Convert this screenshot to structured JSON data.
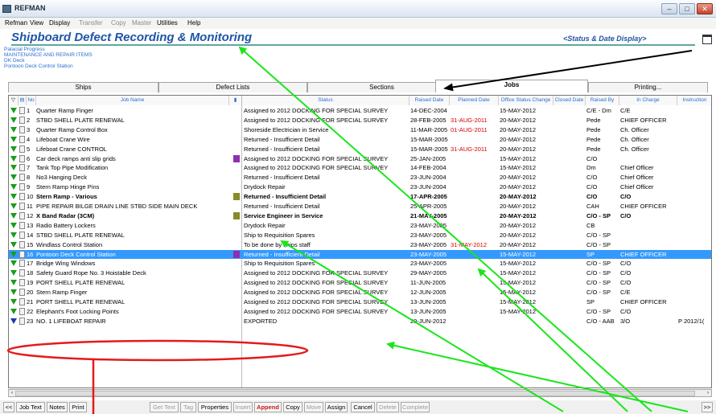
{
  "window": {
    "title": "REFMAN",
    "minimize": "–",
    "maximize": "□",
    "close": "✕"
  },
  "menu": [
    {
      "label": "Refman",
      "enabled": true
    },
    {
      "label": "View",
      "enabled": true
    },
    {
      "label": "Display",
      "enabled": true
    },
    {
      "label": "Transfer",
      "enabled": false
    },
    {
      "label": "Copy",
      "enabled": false
    },
    {
      "label": "Master",
      "enabled": false
    },
    {
      "label": "Utilities",
      "enabled": true
    },
    {
      "label": "Help",
      "enabled": true
    }
  ],
  "header": {
    "title": "Shipboard Defect Recording & Monitoring",
    "status_link": "<Status & Date Display>"
  },
  "breadcrumbs": [
    "Palacial Progress",
    "MAINTENANCE AND REPAIR ITEMS",
    "DK Deck",
    "Pontoon Deck Control Station"
  ],
  "tabs": [
    {
      "label": "Ships",
      "active": false
    },
    {
      "label": "Defect Lists",
      "active": false
    },
    {
      "label": "Sections",
      "active": false
    },
    {
      "label": "Jobs",
      "active": true
    },
    {
      "label": "Printing...",
      "active": false
    }
  ],
  "columns": {
    "no": "No",
    "job": "Job Name",
    "status": "Status",
    "raised": "Raised Date",
    "planned": "Planned Date",
    "office": "Office Status Change",
    "closed": "Closed Date",
    "by": "Raised By",
    "charge": "In Charge",
    "instr": "Instruction"
  },
  "rows": [
    {
      "no": "1",
      "job": "Quarter Ramp Finger",
      "status": "Assigned to 2012 DOCKING FOR SPECIAL SURVEY",
      "raised": "14-DEC-2004",
      "planned": "",
      "office": "15-MAY-2012",
      "closed": "",
      "by": "C/E - Dm",
      "charge": "C/E",
      "instr": "",
      "bold": false,
      "flag": "",
      "icon": "green"
    },
    {
      "no": "2",
      "job": "STBD SHELL PLATE RENEWAL",
      "status": "Assigned to 2012 DOCKING FOR SPECIAL SURVEY",
      "raised": "28-FEB-2005",
      "planned": "31-AUG-2011",
      "office": "20-MAY-2012",
      "closed": "",
      "by": "Pede",
      "charge": "CHIEF OFFICER",
      "instr": "",
      "bold": false,
      "flag": "",
      "icon": "green"
    },
    {
      "no": "3",
      "job": "Quarter Ramp Control Box",
      "status": "Shoreside Electrician in Service",
      "raised": "11-MAR-2005",
      "planned": "01-AUG-2011",
      "office": "20-MAY-2012",
      "closed": "",
      "by": "Pede",
      "charge": "Ch. Officer",
      "instr": "",
      "bold": false,
      "flag": "",
      "icon": "green"
    },
    {
      "no": "4",
      "job": "Lifeboat Crane Wire",
      "status": "Returned - Insufficient Detail",
      "raised": "15-MAR-2005",
      "planned": "",
      "office": "20-MAY-2012",
      "closed": "",
      "by": "Pede",
      "charge": "Ch. Officer",
      "instr": "",
      "bold": false,
      "flag": "",
      "icon": "green"
    },
    {
      "no": "5",
      "job": "Lifeboat Crane CONTROL",
      "status": "Returned - Insufficient Detail",
      "raised": "15-MAR-2005",
      "planned": "31-AUG-2011",
      "office": "20-MAY-2012",
      "closed": "",
      "by": "Pede",
      "charge": "Ch. Officer",
      "instr": "",
      "bold": false,
      "flag": "",
      "icon": "green"
    },
    {
      "no": "6",
      "job": "Car deck ramps anti slip grids",
      "status": "Assigned to 2012 DOCKING FOR SPECIAL SURVEY",
      "raised": "25-JAN-2005",
      "planned": "",
      "office": "15-MAY-2012",
      "closed": "",
      "by": "C/O",
      "charge": "",
      "instr": "",
      "bold": false,
      "flag": "purple",
      "icon": "green"
    },
    {
      "no": "7",
      "job": "Tank Top Pipe Modification",
      "status": "Assigned to 2012 DOCKING FOR SPECIAL SURVEY",
      "raised": "14-FEB-2004",
      "planned": "",
      "office": "15-MAY-2012",
      "closed": "",
      "by": "Dm",
      "charge": "Chief Officer",
      "instr": "",
      "bold": false,
      "flag": "",
      "icon": "green"
    },
    {
      "no": "8",
      "job": "No3 Hanging Deck",
      "status": "Returned - Insufficient Detail",
      "raised": "23-JUN-2004",
      "planned": "",
      "office": "20-MAY-2012",
      "closed": "",
      "by": "C/O",
      "charge": "Chief Officer",
      "instr": "",
      "bold": false,
      "flag": "",
      "icon": "green"
    },
    {
      "no": "9",
      "job": "Stern Ramp Hinge Pins",
      "status": "Drydock Repair",
      "raised": "23-JUN-2004",
      "planned": "",
      "office": "20-MAY-2012",
      "closed": "",
      "by": "C/O",
      "charge": "Chief Officer",
      "instr": "",
      "bold": false,
      "flag": "",
      "icon": "green"
    },
    {
      "no": "10",
      "job": "Stern Ramp - Various",
      "status": "Returned - Insufficient Detail",
      "raised": "17-APR-2005",
      "planned": "",
      "office": "20-MAY-2012",
      "closed": "",
      "by": "C/O",
      "charge": "C/O",
      "instr": "",
      "bold": true,
      "flag": "olive",
      "icon": "green"
    },
    {
      "no": "11",
      "job": "PIPE REPAIR BILGE DRAIN LINE STBD SIDE MAIN DECK",
      "status": "Returned - Insufficient Detail",
      "raised": "25-APR-2005",
      "planned": "",
      "office": "20-MAY-2012",
      "closed": "",
      "by": "CAH",
      "charge": "CHIEF OFFICER",
      "instr": "",
      "bold": false,
      "flag": "",
      "icon": "green"
    },
    {
      "no": "12",
      "job": "X Band Radar (3CM)",
      "status": "Service Engineer in Service",
      "raised": "21-MAY-2005",
      "planned": "",
      "office": "20-MAY-2012",
      "closed": "",
      "by": "C/O - SP",
      "charge": "C/O",
      "instr": "",
      "bold": true,
      "flag": "olive",
      "icon": "green"
    },
    {
      "no": "13",
      "job": "Radio Battery Lockers",
      "status": "Drydock Repair",
      "raised": "23-MAY-2005",
      "planned": "",
      "office": "20-MAY-2012",
      "closed": "",
      "by": "CB",
      "charge": "",
      "instr": "",
      "bold": false,
      "flag": "",
      "icon": "green"
    },
    {
      "no": "14",
      "job": "STBD SHELL PLATE RENEWAL",
      "status": "Ship to Requisition Spares",
      "raised": "23-MAY-2005",
      "planned": "",
      "office": "20-MAY-2012",
      "closed": "",
      "by": "C/O - SP",
      "charge": "",
      "instr": "",
      "bold": false,
      "flag": "",
      "icon": "green"
    },
    {
      "no": "15",
      "job": "Windlass Control Station",
      "status": "To be done by ships staff",
      "raised": "23-MAY-2005",
      "planned": "31-MAY-2012",
      "office": "20-MAY-2012",
      "closed": "",
      "by": "C/O - SP",
      "charge": "",
      "instr": "",
      "bold": false,
      "flag": "",
      "icon": "green"
    },
    {
      "no": "16",
      "job": "Pontoon Deck Control Station",
      "status": "Returned - Insufficient Detail",
      "raised": "23-MAY-2005",
      "planned": "",
      "office": "15-MAY-2012",
      "closed": "",
      "by": "SP",
      "charge": "CHIEF OFFICER",
      "instr": "",
      "bold": false,
      "flag": "purple",
      "icon": "green",
      "selected": true
    },
    {
      "no": "17",
      "job": "Bridge Wing Windows",
      "status": "Ship to Requisition Spares",
      "raised": "23-MAY-2005",
      "planned": "",
      "office": "15-MAY-2012",
      "closed": "",
      "by": "C/O - SP",
      "charge": "C/O",
      "instr": "",
      "bold": false,
      "flag": "",
      "icon": "green"
    },
    {
      "no": "18",
      "job": "Safety Guard Rope No. 3 Hoistable Deck",
      "status": "Assigned to 2012 DOCKING FOR SPECIAL SURVEY",
      "raised": "29-MAY-2005",
      "planned": "",
      "office": "15-MAY-2012",
      "closed": "",
      "by": "C/O - SP",
      "charge": "C/O",
      "instr": "",
      "bold": false,
      "flag": "",
      "icon": "green"
    },
    {
      "no": "19",
      "job": "PORT SHELL PLATE RENEWAL",
      "status": "Assigned to 2012 DOCKING FOR SPECIAL SURVEY",
      "raised": "11-JUN-2005",
      "planned": "",
      "office": "15-MAY-2012",
      "closed": "",
      "by": "C/O - SP",
      "charge": "C/O",
      "instr": "",
      "bold": false,
      "flag": "",
      "icon": "green"
    },
    {
      "no": "20",
      "job": "Stern Ramp Finger",
      "status": "Assigned to 2012 DOCKING FOR SPECIAL SURVEY",
      "raised": "12-JUN-2005",
      "planned": "",
      "office": "15-MAY-2012",
      "closed": "",
      "by": "C/O - SP",
      "charge": "C/E",
      "instr": "",
      "bold": false,
      "flag": "",
      "icon": "green"
    },
    {
      "no": "21",
      "job": "PORT SHELL PLATE RENEWAL",
      "status": "Assigned to 2012 DOCKING FOR SPECIAL SURVEY",
      "raised": "13-JUN-2005",
      "planned": "",
      "office": "15-MAY-2012",
      "closed": "",
      "by": "SP",
      "charge": "CHIEF OFFICER",
      "instr": "",
      "bold": false,
      "flag": "",
      "icon": "green"
    },
    {
      "no": "22",
      "job": "Elephant's Foot Locking Points",
      "status": "Assigned to 2012 DOCKING FOR SPECIAL SURVEY",
      "raised": "13-JUN-2005",
      "planned": "",
      "office": "15-MAY-2012",
      "closed": "",
      "by": "C/O - SP",
      "charge": "C/O",
      "instr": "",
      "bold": false,
      "flag": "",
      "icon": "green"
    },
    {
      "no": "23",
      "job": "NO. 1 LIFEBOAT REPAIR",
      "status": "EXPORTED",
      "raised": "29-JUN-2012",
      "planned": "",
      "office": "",
      "closed": "",
      "by": "C/O - AAB",
      "charge": "3/O",
      "instr": "P 2012/1(",
      "bold": false,
      "flag": "",
      "icon": "blue"
    }
  ],
  "scroll": {
    "left": "‹",
    "right": "›"
  },
  "buttons": [
    {
      "label": "<<",
      "style": "normal"
    },
    {
      "label": "Job Text",
      "style": "normal"
    },
    {
      "label": "Notes",
      "style": "normal"
    },
    {
      "label": "Print",
      "style": "normal"
    },
    {
      "label": "Get Text",
      "style": "disabled"
    },
    {
      "label": "Tag",
      "style": "disabled"
    },
    {
      "label": "Properties",
      "style": "normal"
    },
    {
      "label": "Insert",
      "style": "disabled"
    },
    {
      "label": "Append",
      "style": "red"
    },
    {
      "label": "Copy",
      "style": "normal"
    },
    {
      "label": "Move",
      "style": "disabled"
    },
    {
      "label": "Assign",
      "style": "normal"
    },
    {
      "label": "Cancel",
      "style": "normal"
    },
    {
      "label": "Delete",
      "style": "disabled"
    },
    {
      "label": "Complete",
      "style": "disabled"
    },
    {
      "label": ">>",
      "style": "normal"
    }
  ],
  "colors": {
    "selected_row": "#3399ff",
    "planned_overdue": "#d40000",
    "annotation_arrow": "#19e619",
    "annotation_ring": "#e41a1a",
    "black_arrow": "#000000"
  }
}
